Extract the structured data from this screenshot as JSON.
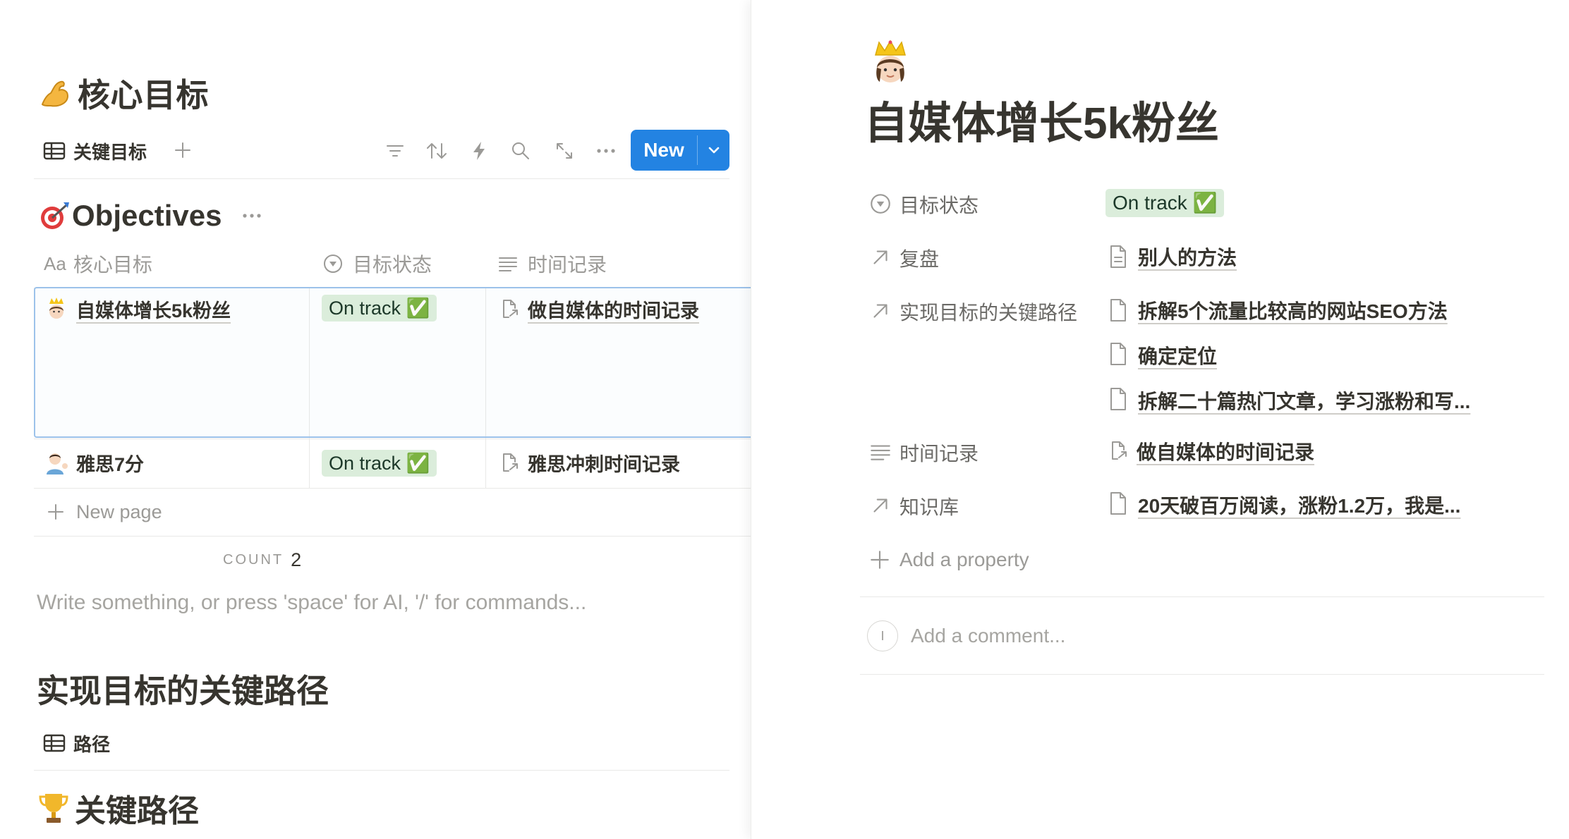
{
  "left": {
    "page_title": "核心目标",
    "page_icon": "flexed-biceps",
    "view_tab": "关键目标",
    "new_button": "New",
    "db_title": "Objectives",
    "db_icon": "target-dart",
    "columns": [
      "核心目标",
      "目标状态",
      "时间记录"
    ],
    "column_icon_name": "Aa",
    "rows": [
      {
        "name": "自媒体增长5k粉丝",
        "icon": "princess-emoji",
        "status": "On track ✅",
        "relation": "做自媒体的时间记录"
      },
      {
        "name": "雅思7分",
        "icon": "person-tipping-hand-emoji",
        "status": "On track ✅",
        "relation": "雅思冲刺时间记录"
      }
    ],
    "new_page": "New page",
    "count_label": "COUNT",
    "count_value": "2",
    "placeholder": "Write something, or press 'space' for AI, '/' for commands...",
    "section_heading": "实现目标的关键路径",
    "section_view_tab": "路径",
    "section_db_title": "关键路径",
    "section_db_icon": "trophy"
  },
  "right": {
    "page_icon": "princess-emoji",
    "page_title": "自媒体增长5k粉丝",
    "properties": [
      {
        "label": "目标状态",
        "icon": "status-icon",
        "type": "status",
        "values": [
          "On track ✅"
        ]
      },
      {
        "label": "复盘",
        "icon": "relation-arrow-icon",
        "type": "relation",
        "values": [
          "别人的方法"
        ]
      },
      {
        "label": "实现目标的关键路径",
        "icon": "relation-arrow-icon",
        "type": "relation",
        "values": [
          "拆解5个流量比较高的网站SEO方法",
          "确定定位",
          "拆解二十篇热门文章，学习涨粉和写..."
        ]
      },
      {
        "label": "时间记录",
        "icon": "text-lines-icon",
        "type": "relation",
        "values": [
          "做自媒体的时间记录"
        ]
      },
      {
        "label": "知识库",
        "icon": "relation-arrow-icon",
        "type": "relation",
        "values": [
          "20天破百万阅读，涨粉1.2万，我是..."
        ]
      }
    ],
    "add_property": "Add a property",
    "comment_placeholder": "Add a comment...",
    "avatar_letter": "I"
  },
  "colors": {
    "accent_blue": "#2383e2",
    "status_green_bg": "#dbeddb",
    "status_green_text": "#1c3829",
    "text": "#37352f",
    "muted": "#9b9a97"
  }
}
